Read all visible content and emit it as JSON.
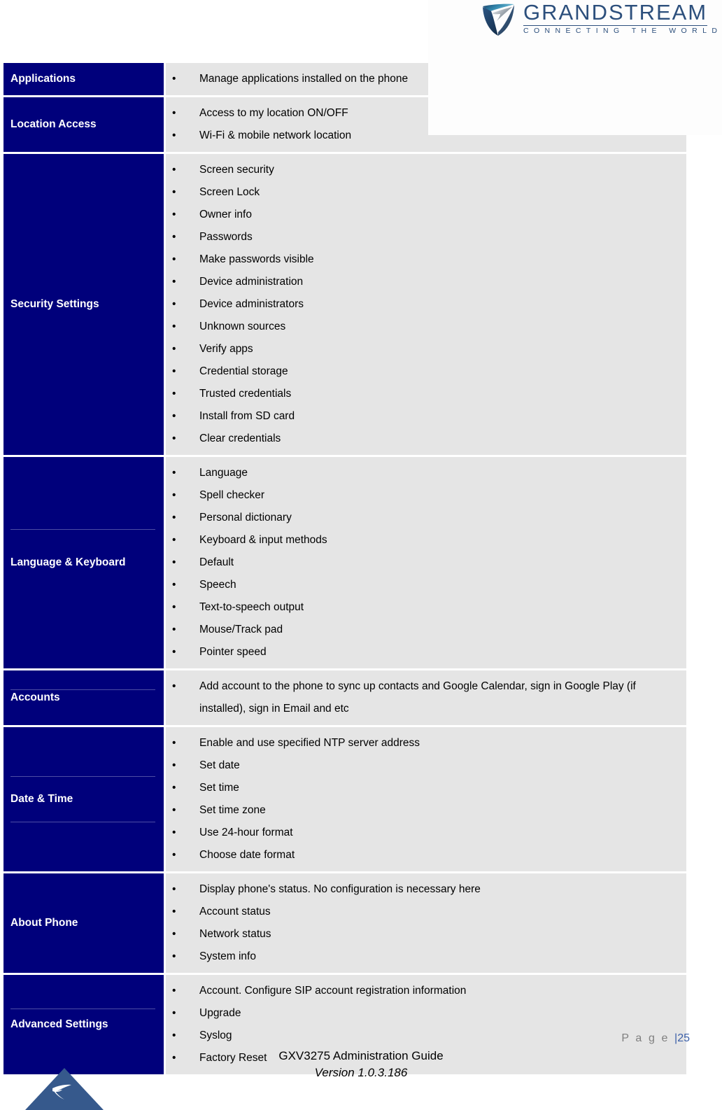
{
  "document": {
    "brand": {
      "logo_icon": "grandstream-swoosh-icon",
      "wordmark": "GRANDSTREAM",
      "tagline": "CONNECTING THE WORLD",
      "brand_color": "#2c4f7c"
    },
    "colors": {
      "label_cell_bg": "#00007b",
      "value_cell_bg": "#e5e5e5",
      "label_text": "#ffffff",
      "page_number_accent": "#3b5fa8",
      "footer_mark": "#36598c"
    },
    "footer": {
      "page_label": "P a g e ",
      "page_separator": "|",
      "page_number": "25",
      "guide_title": "GXV3275 Administration Guide",
      "version": "Version 1.0.3.186",
      "mark_icon": "grandstream-triangle-icon"
    }
  },
  "table": {
    "rows": [
      {
        "label": "Applications",
        "label_dividers": "none",
        "items": [
          "Manage applications installed on the phone"
        ]
      },
      {
        "label": "Location Access",
        "label_dividers": "none",
        "items": [
          "Access to my location ON/OFF",
          "Wi-Fi & mobile network location"
        ]
      },
      {
        "label": "Security Settings",
        "label_dividers": "none",
        "items": [
          "Screen security",
          "Screen Lock",
          "Owner info",
          "Passwords",
          "Make passwords visible",
          "Device administration",
          "Device administrators",
          "Unknown sources",
          "Verify apps",
          "Credential storage",
          "Trusted credentials",
          "Install from SD card",
          "Clear credentials"
        ]
      },
      {
        "label": "Language & Keyboard",
        "label_dividers": "top",
        "items": [
          "Language",
          "Spell checker",
          "Personal dictionary",
          "Keyboard & input methods",
          "Default",
          "Speech",
          "Text-to-speech output",
          "Mouse/Track pad",
          "Pointer speed"
        ]
      },
      {
        "label": "Accounts",
        "label_dividers": "top",
        "items": [
          "Add account to the phone to sync up contacts and Google Calendar, sign in Google Play (if installed), sign in Email and etc"
        ]
      },
      {
        "label": "Date & Time",
        "label_dividers": "both",
        "items": [
          "Enable and use specified NTP server address",
          "Set date",
          "Set time",
          "Set time zone",
          "Use 24-hour format",
          "Choose date format"
        ]
      },
      {
        "label": "About Phone",
        "label_dividers": "none",
        "items": [
          "Display phone's status. No configuration is necessary here",
          "Account status",
          "Network status",
          "System info"
        ]
      },
      {
        "label": "Advanced Settings",
        "label_dividers": "top",
        "items": [
          "Account. Configure SIP account registration information",
          "Upgrade",
          "Syslog",
          "Factory Reset"
        ]
      }
    ]
  }
}
